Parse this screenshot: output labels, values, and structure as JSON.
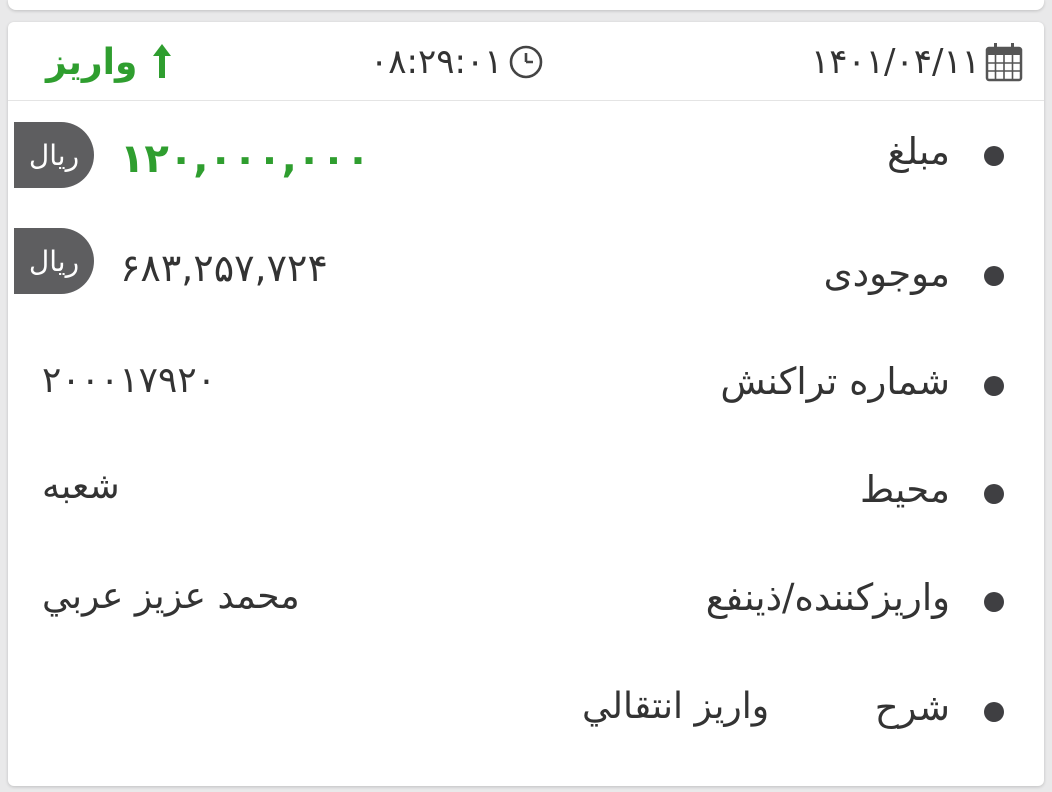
{
  "header": {
    "date": "۱۴۰۱/۰۴/۱۱",
    "date_icon": "calendar-icon",
    "time": "۰۸:۲۹:۰۱",
    "time_icon": "clock-icon",
    "type_label": "واریز",
    "type_icon": "arrow-up-icon",
    "type_color": "#2f9e2f"
  },
  "rows": [
    {
      "label": "مبلغ",
      "value": "۱۲۰,۰۰۰,۰۰۰",
      "currency": "ریال"
    },
    {
      "label": "موجودی",
      "value": "۶۸۳,۲۵۷,۷۲۴",
      "currency": "ریال"
    },
    {
      "label": "شماره تراکنش",
      "value": "۲۰۰۰۱۷۹۲۰"
    },
    {
      "label": "محیط",
      "value": "شعبه"
    },
    {
      "label": "واریزکننده/ذینفع",
      "value": "محمد عزیز عربي"
    },
    {
      "label": "شرح",
      "value": "واريز انتقالي"
    }
  ],
  "colors": {
    "accent_green": "#2f9e2f",
    "currency_badge": "#5e5e60",
    "text": "#333333"
  }
}
